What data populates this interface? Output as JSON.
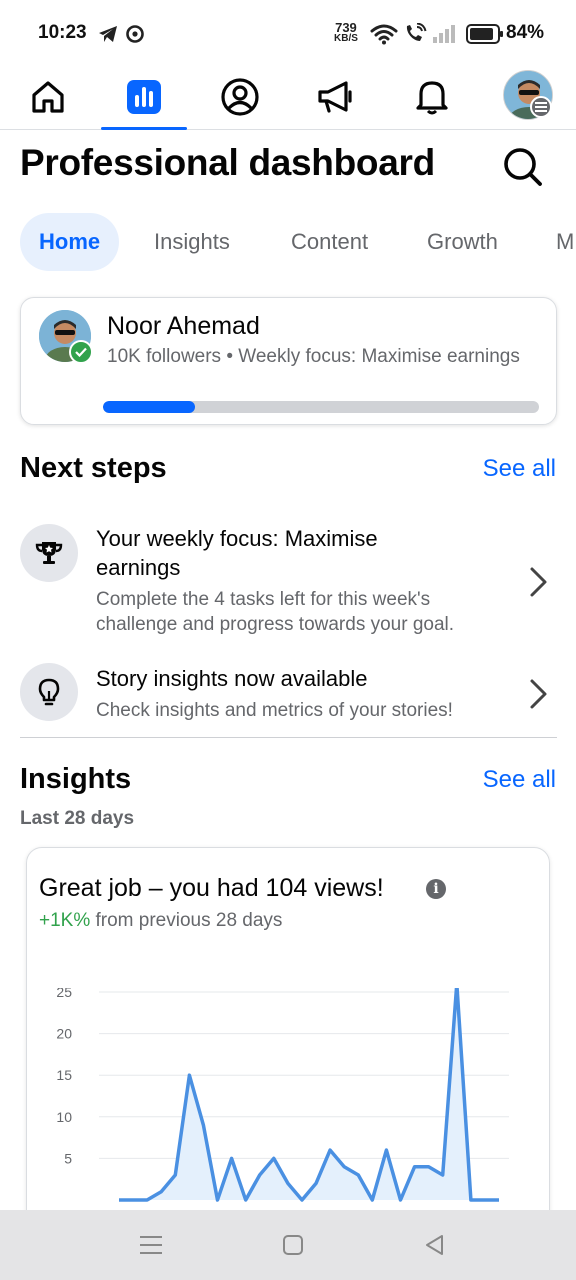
{
  "status_bar": {
    "time": "10:23",
    "net_speed_value": "739",
    "net_speed_unit": "KB/S",
    "battery": "84%"
  },
  "top_nav": {
    "items": [
      {
        "name": "home",
        "icon": "home-icon"
      },
      {
        "name": "dashboard",
        "icon": "bar-chart-icon",
        "active": true
      },
      {
        "name": "profile",
        "icon": "user-circle-icon"
      },
      {
        "name": "ads",
        "icon": "megaphone-icon"
      },
      {
        "name": "notifications",
        "icon": "bell-icon"
      },
      {
        "name": "menu",
        "icon": "avatar-menu-icon"
      }
    ]
  },
  "header": {
    "title": "Professional dashboard",
    "search_icon": "search-icon"
  },
  "tabs": [
    {
      "label": "Home",
      "active": true
    },
    {
      "label": "Insights"
    },
    {
      "label": "Content"
    },
    {
      "label": "Growth"
    },
    {
      "label": "M"
    }
  ],
  "profile": {
    "name": "Noor Ahemad",
    "subtitle": "10K followers • Weekly focus: Maximise earnings",
    "progress": 0.21
  },
  "next_steps": {
    "title": "Next steps",
    "see_all": "See all",
    "items": [
      {
        "icon": "trophy-icon",
        "title": "Your weekly focus: Maximise earnings",
        "description": "Complete the 4 tasks left for this week's challenge and progress towards your goal."
      },
      {
        "icon": "lightbulb-icon",
        "title": "Story insights now available",
        "description": "Check insights and metrics of your stories!"
      }
    ]
  },
  "insights": {
    "title": "Insights",
    "see_all": "See all",
    "period": "Last 28 days",
    "card": {
      "headline": "Great job – you had 104 views!",
      "delta_positive": "+1K%",
      "delta_rest": " from previous 28 days"
    }
  },
  "chart_data": {
    "type": "area",
    "y_ticks": [
      25,
      20,
      15,
      10,
      5
    ],
    "x": [
      1,
      2,
      3,
      4,
      5,
      6,
      7,
      8,
      9,
      10,
      11,
      12,
      13,
      14,
      15,
      16,
      17,
      18,
      19,
      20,
      21,
      22,
      23,
      24,
      25,
      26,
      27,
      28
    ],
    "values": [
      0,
      0,
      0,
      1,
      3,
      15,
      9,
      0,
      5,
      0,
      3,
      5,
      2,
      0,
      2,
      6,
      4,
      3,
      0,
      6,
      0,
      4,
      4,
      3,
      26,
      0,
      0,
      0
    ],
    "ylim": [
      0,
      27
    ],
    "color": "#4a90e2",
    "fill_color": "#e4f0fc",
    "grid": true
  },
  "system_nav": {
    "buttons": [
      "menu-lines-icon",
      "square-home-icon",
      "triangle-back-icon"
    ]
  }
}
